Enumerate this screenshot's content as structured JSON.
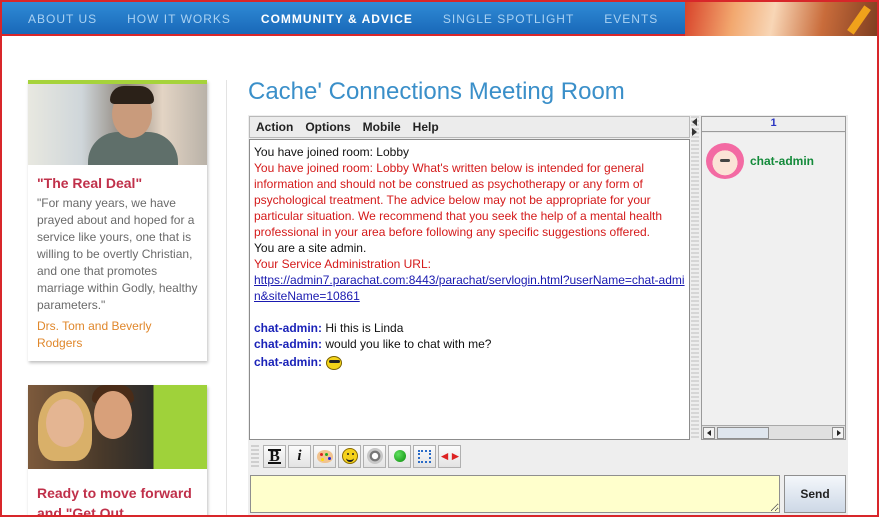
{
  "nav": {
    "items": [
      {
        "label": "ABOUT US",
        "active": false
      },
      {
        "label": "HOW IT WORKS",
        "active": false
      },
      {
        "label": "COMMUNITY & ADVICE",
        "active": true
      },
      {
        "label": "SINGLE SPOTLIGHT",
        "active": false
      },
      {
        "label": "EVENTS",
        "active": false
      }
    ]
  },
  "sidebar": {
    "card1": {
      "title": "\"The Real Deal\"",
      "quote": "\"For many years, we have prayed about and hoped for a service like yours, one that is willing to be overtly Christian, and one that promotes marriage within Godly, healthy parameters.\"",
      "author": "Drs. Tom and Beverly Rodgers"
    },
    "card2": {
      "title": "Ready to move forward and \"Get Out"
    }
  },
  "room": {
    "title": "Cache' Connections Meeting Room"
  },
  "chat": {
    "menu": [
      "Action",
      "Options",
      "Mobile",
      "Help"
    ],
    "messages": {
      "m0": "You have joined room: Lobby",
      "m1": "You have joined room: Lobby What's written below is intended for general information and should not be construed as psychotherapy or any form of psychological treatment. The advice below may not be appropriate for your particular situation. We recommend that you seek the help of a mental health professional in your area before following any specific suggestions offered.",
      "m2": "You are a site admin.",
      "m3": "Your Service Administration URL:",
      "m4": "https://admin7.parachat.com:8443/parachat/servlogin.html?userName=chat-admin&siteName=10861",
      "c1_sender": "chat-admin:",
      "c1_text": " Hi this is Linda",
      "c2_sender": "chat-admin:",
      "c2_text": " would you like to chat with me?",
      "c3_sender": "chat-admin:"
    },
    "users": {
      "count": "1",
      "list": [
        {
          "name": "chat-admin"
        }
      ]
    },
    "input": {
      "value": ""
    },
    "send_label": "Send"
  }
}
